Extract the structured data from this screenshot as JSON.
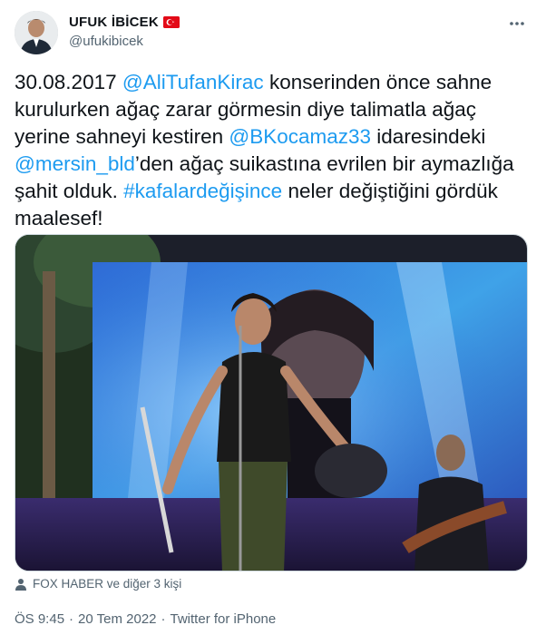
{
  "author": {
    "display_name": "UFUK İBİCEK",
    "handle": "@ufukibicek",
    "flag": "turkey-flag"
  },
  "tweet": {
    "date_prefix": "30.08.2017 ",
    "mention1": "@AliTufanKirac",
    "text1": " konserinden önce sahne kurulurken ağaç zarar görmesin diye talimatla ağaç yerine sahneyi kestiren ",
    "mention2": "@BKocamaz33",
    "text2": " idaresindeki ",
    "mention3": "@mersin_bld",
    "text3": "’den ağaç suikastına evrilen bir aymazlığa şahit olduk. ",
    "hashtag": "#kafalardeğişince",
    "text4": " neler değiştiğini gördük maalesef!"
  },
  "tagged_people": "FOX HABER ve diğer 3 kişi",
  "footer": {
    "time": "ÖS 9:45",
    "sep1": "·",
    "date": "20 Tem 2022",
    "sep2": "·",
    "source": "Twitter for iPhone"
  },
  "colors": {
    "link": "#1d9bf0",
    "secondary_text": "#536471",
    "flag_red": "#e30a17"
  }
}
